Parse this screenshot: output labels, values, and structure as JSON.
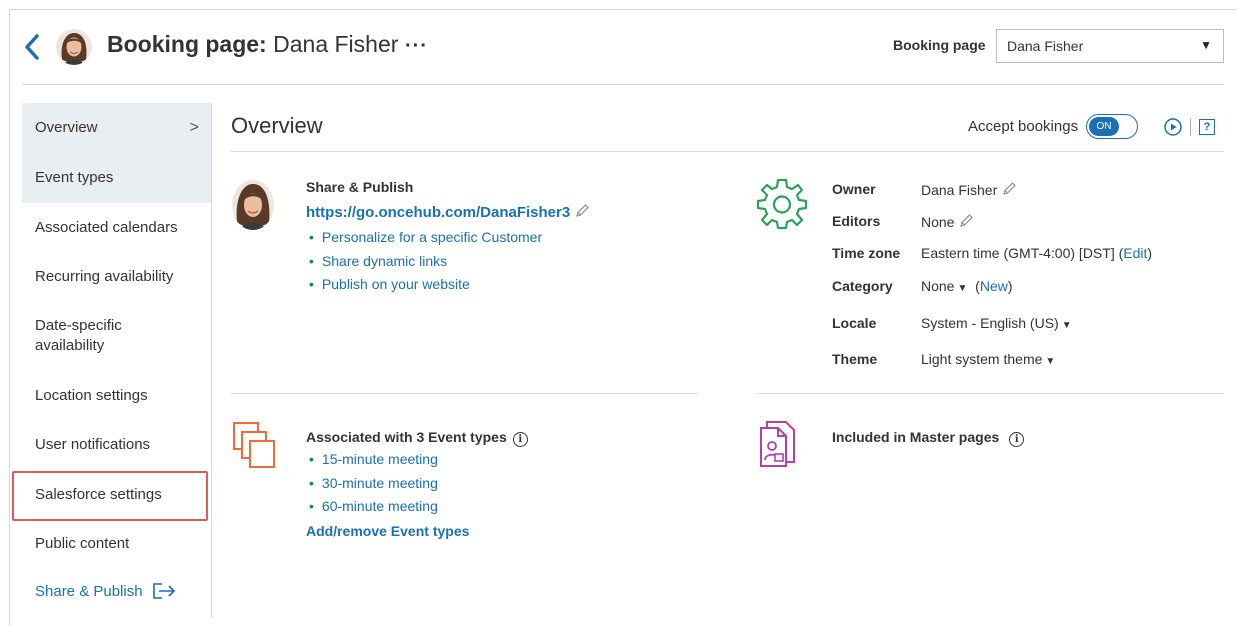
{
  "header": {
    "title_prefix": "Booking page:",
    "title_name": "Dana Fisher",
    "more_label": "···",
    "selector_label": "Booking page",
    "selector_value": "Dana Fisher"
  },
  "sidebar": {
    "items": [
      {
        "label": "Overview"
      },
      {
        "label": "Event types"
      },
      {
        "label": "Associated calendars"
      },
      {
        "label": "Recurring availability"
      },
      {
        "label": "Date-specific availability"
      },
      {
        "label": "Location settings"
      },
      {
        "label": "User notifications"
      },
      {
        "label": "Salesforce settings"
      },
      {
        "label": "Public content"
      },
      {
        "label": "Share & Publish"
      }
    ]
  },
  "main": {
    "title": "Overview",
    "accept_label": "Accept bookings",
    "toggle_label": "ON",
    "help_label": "?",
    "share": {
      "title": "Share & Publish",
      "url": "https://go.oncehub.com/DanaFisher3",
      "links": [
        "Personalize for a specific Customer",
        "Share dynamic links",
        "Publish on your website"
      ]
    },
    "props": {
      "owner_key": "Owner",
      "owner_val": "Dana Fisher",
      "editors_key": "Editors",
      "editors_val": "None",
      "tz_key": "Time zone",
      "tz_val": "Eastern time (GMT-4:00) [DST] (",
      "tz_edit": "Edit",
      "tz_close": ")",
      "cat_key": "Category",
      "cat_val": "None",
      "cat_open": "(",
      "cat_new": "New",
      "cat_close": ")",
      "locale_key": "Locale",
      "locale_val": "System - English (US)",
      "theme_key": "Theme",
      "theme_val": "Light system theme"
    },
    "event_types": {
      "title": "Associated with 3 Event types",
      "items": [
        "15-minute meeting",
        "30-minute meeting",
        "60-minute meeting"
      ],
      "add_remove": "Add/remove Event types"
    },
    "master": {
      "title": "Included in Master pages"
    }
  },
  "colors": {
    "accent": "#1a6fb5",
    "highlight": "#e35a5a",
    "orange": "#ef6c3a",
    "purple": "#b53fa8",
    "green": "#2e9e5a"
  }
}
